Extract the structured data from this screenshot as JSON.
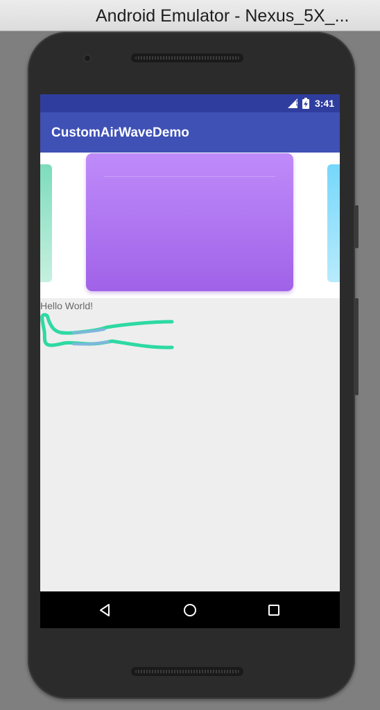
{
  "window": {
    "title": "Android Emulator - Nexus_5X_..."
  },
  "status_bar": {
    "time": "3:41",
    "icons": [
      "signal-icon",
      "battery-charging-icon"
    ]
  },
  "app_bar": {
    "title": "CustomAirWaveDemo"
  },
  "main": {
    "text": "Hello World!"
  },
  "nav_bar": {
    "buttons": [
      "back-icon",
      "home-icon",
      "recents-icon"
    ]
  },
  "colors": {
    "primary_dark": "#2f3e9e",
    "primary": "#3f51b5",
    "card_center": "#b27af4",
    "card_left": "#9fe6cd",
    "card_right": "#91e0fb",
    "wave_primary": "#2ed9a2",
    "wave_secondary": "#7fb6dd"
  }
}
